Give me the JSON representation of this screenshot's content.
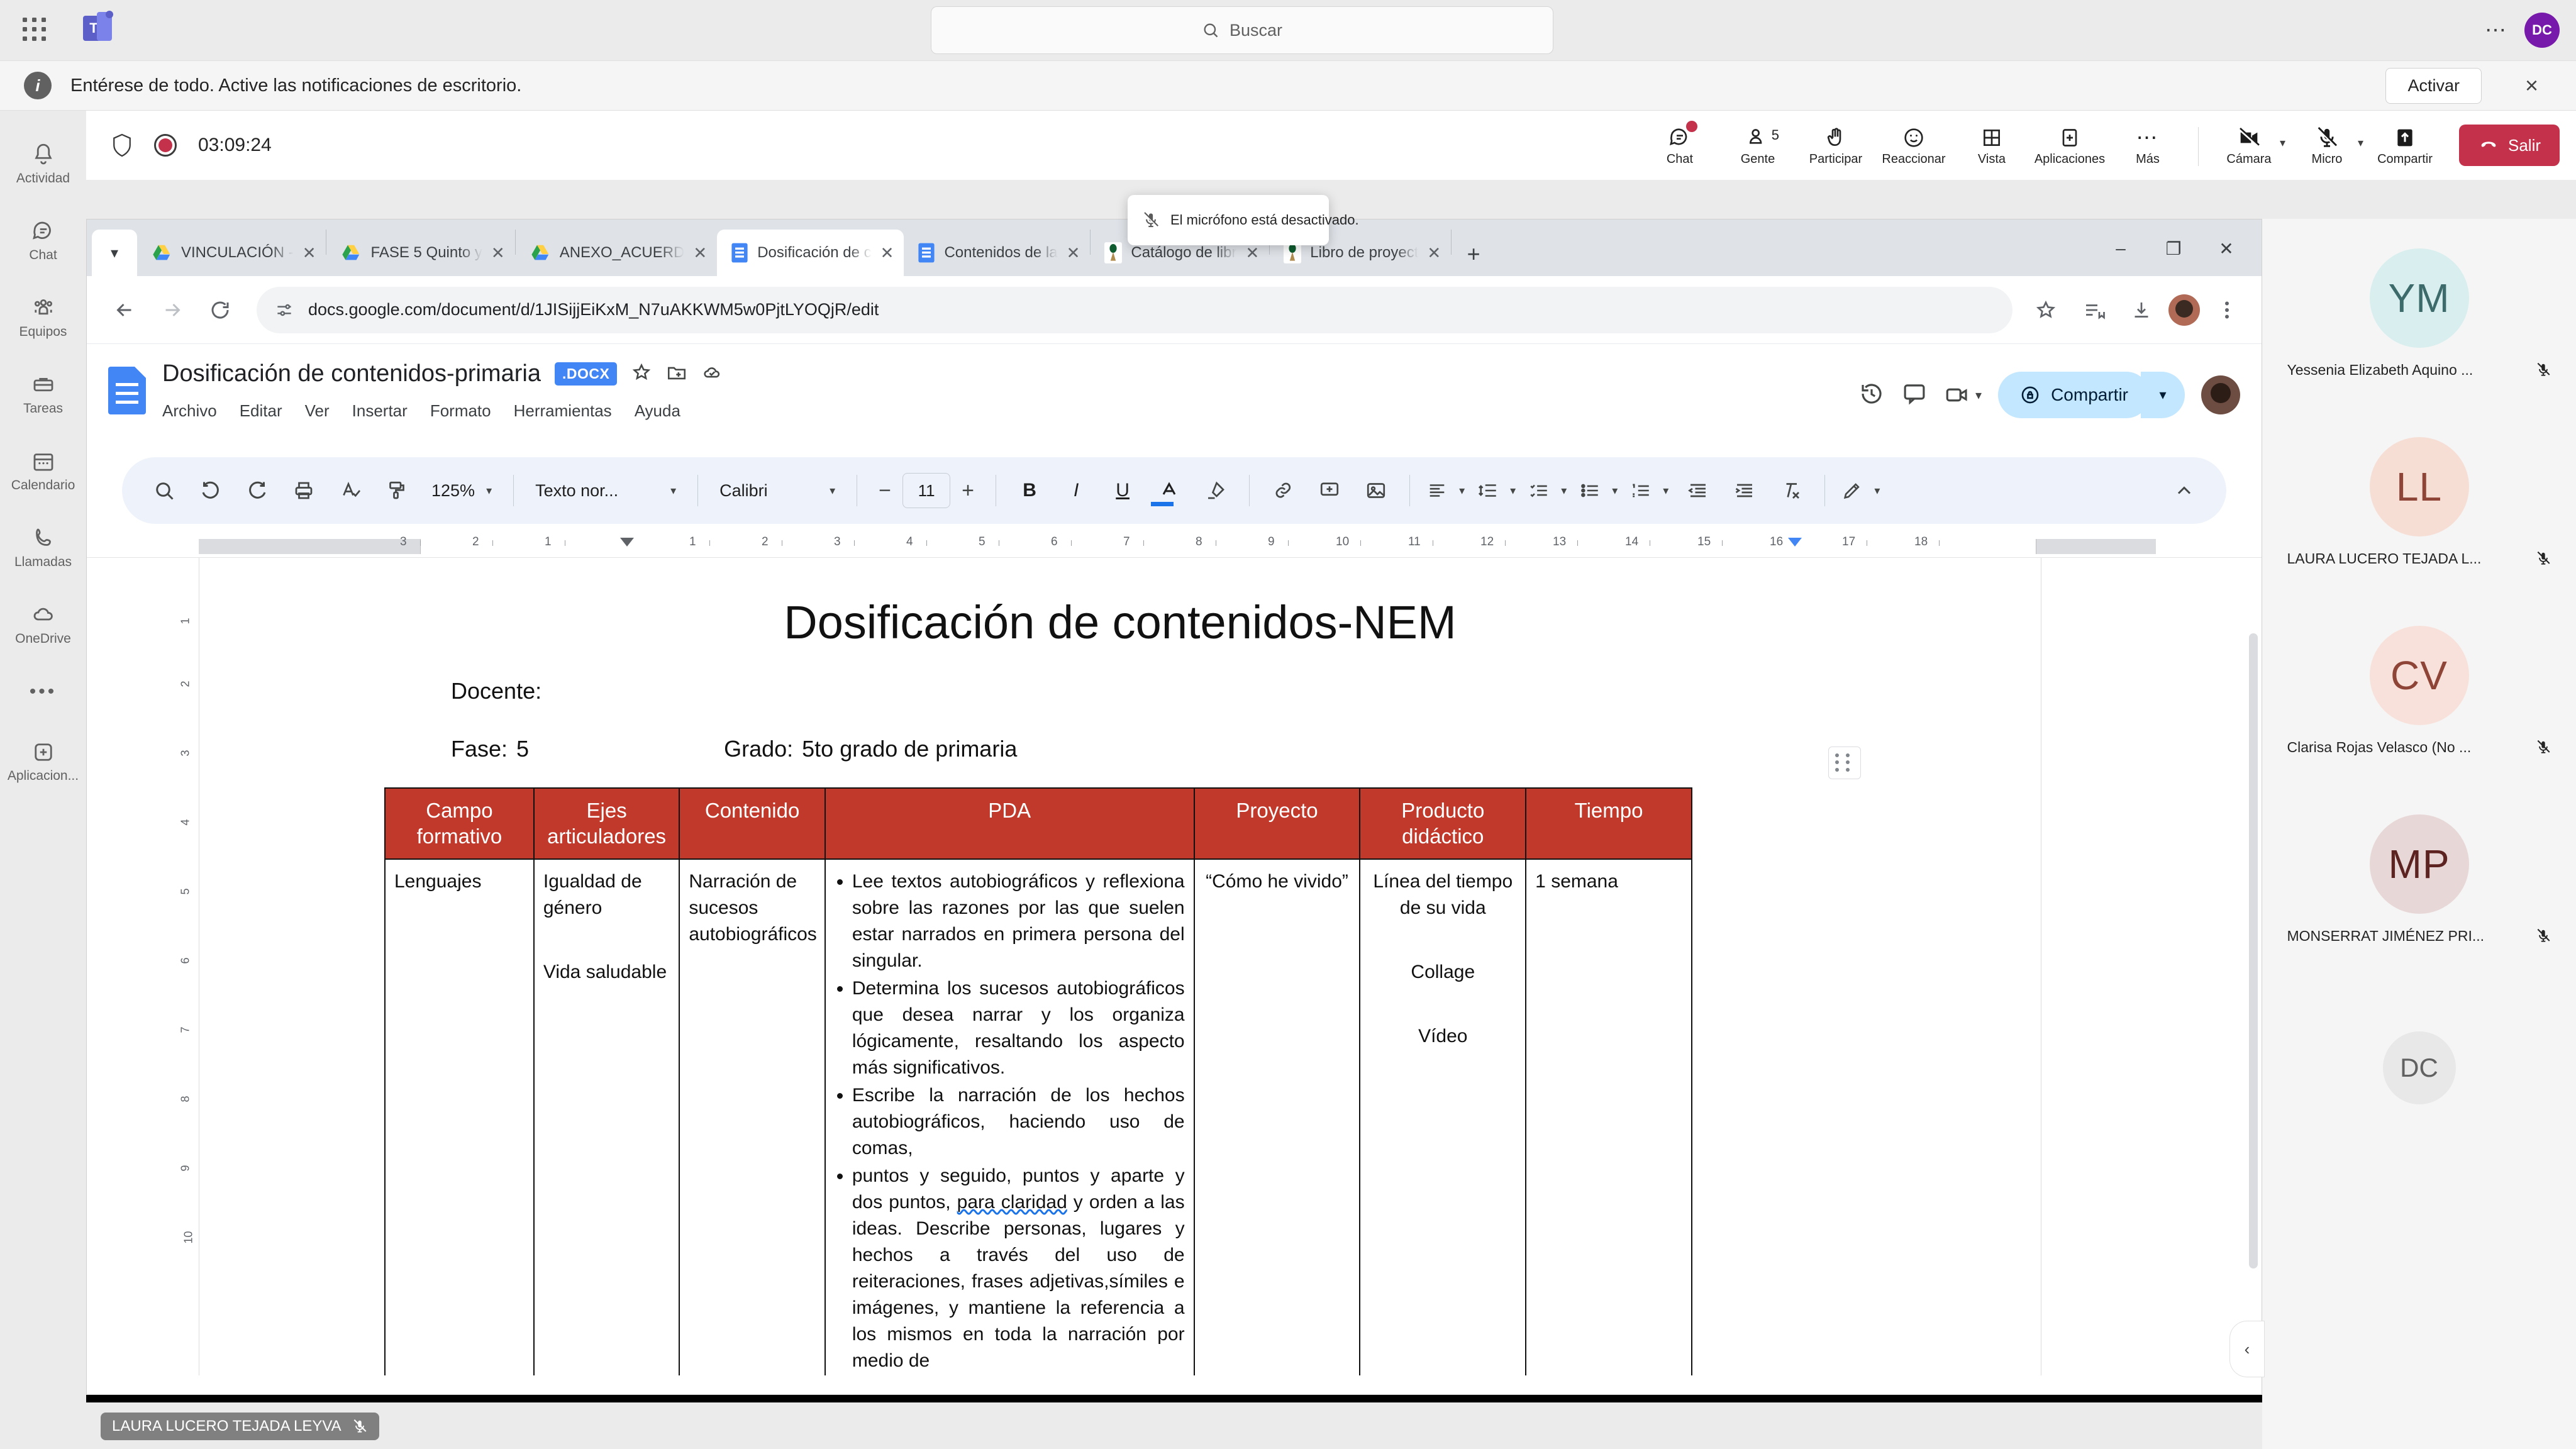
{
  "teams": {
    "search_placeholder": "Buscar",
    "user_initials": "DC",
    "more_icon": "ellipsis-icon",
    "notification": {
      "text": "Entérese de todo. Active las notificaciones de escritorio.",
      "action_label": "Activar",
      "close_label": "×"
    },
    "rail": [
      {
        "label": "Actividad",
        "icon": "bell-icon"
      },
      {
        "label": "Chat",
        "icon": "chat-bubble-icon"
      },
      {
        "label": "Equipos",
        "icon": "people-icon"
      },
      {
        "label": "Tareas",
        "icon": "tasks-icon"
      },
      {
        "label": "Calendario",
        "icon": "calendar-icon"
      },
      {
        "label": "Llamadas",
        "icon": "phone-icon"
      },
      {
        "label": "OneDrive",
        "icon": "cloud-icon"
      },
      {
        "label": "Aplicacion...",
        "icon": "plus-box-icon"
      }
    ],
    "rail_more": "•••"
  },
  "meeting": {
    "timer": "03:09:24",
    "shield_icon": "shield-icon",
    "record_icon": "record-dot-icon",
    "actions": [
      {
        "label": "Chat",
        "icon": "chat-icon",
        "badge": true
      },
      {
        "label": "Gente",
        "icon": "person-icon",
        "count": "5"
      },
      {
        "label": "Participar",
        "icon": "raise-hand-icon"
      },
      {
        "label": "Reaccionar",
        "icon": "emoji-icon"
      },
      {
        "label": "Vista",
        "icon": "grid-view-icon"
      },
      {
        "label": "Aplicaciones",
        "icon": "apps-plus-icon"
      },
      {
        "label": "Más",
        "icon": "ellipsis-icon"
      }
    ],
    "devices": [
      {
        "label": "Cámara",
        "icon": "camera-off-icon",
        "has_chevron": true
      },
      {
        "label": "Micro",
        "icon": "mic-off-icon",
        "has_chevron": true
      },
      {
        "label": "Compartir",
        "icon": "share-screen-icon",
        "has_chevron": false
      }
    ],
    "leave_label": "Salir",
    "leave_color": "#c4314b",
    "toast": {
      "text": "El micrófono está desactivado.",
      "icon": "mic-off-icon"
    },
    "self_name_pill": {
      "name": "LAURA LUCERO TEJADA LEYVA",
      "icon": "mic-off-icon"
    }
  },
  "participants": [
    {
      "initials": "YM",
      "name": "Yessenia Elizabeth Aquino ...",
      "bg": "#d9eeee",
      "fg": "#3d6b6b",
      "muted": true
    },
    {
      "initials": "LL",
      "name": "LAURA LUCERO TEJADA L...",
      "bg": "#f6ded5",
      "fg": "#8e4436",
      "muted": true
    },
    {
      "initials": "CV",
      "name": "Clarisa Rojas Velasco (No ...",
      "bg": "#f8e1da",
      "fg": "#8e4436",
      "muted": true
    },
    {
      "initials": "MP",
      "name": "MONSERRAT JIMÉNEZ PRI...",
      "bg": "#e8d7d7",
      "fg": "#5c2320",
      "muted": true
    },
    {
      "initials": "DC",
      "name": "",
      "bg": "#e8e8e8",
      "fg": "#616161",
      "muted": false,
      "self": true
    }
  ],
  "browser": {
    "tabs": [
      {
        "title": "VINCULACIÓN -",
        "icon": "google-drive-icon",
        "active": false
      },
      {
        "title": "FASE 5 Quinto y",
        "icon": "google-drive-icon",
        "active": false
      },
      {
        "title": "ANEXO_ACUERD",
        "icon": "google-drive-icon",
        "active": false
      },
      {
        "title": "Dosificación de c",
        "icon": "google-docs-icon",
        "active": true
      },
      {
        "title": "Contenidos de la",
        "icon": "google-docs-icon",
        "active": false
      },
      {
        "title": "Catálogo de libr",
        "icon": "gov-seal-icon",
        "active": false
      },
      {
        "title": "Libro de proyect",
        "icon": "gov-seal-icon",
        "active": false
      }
    ],
    "new_tab_label": "+",
    "window_controls": [
      "–",
      "❐",
      "✕"
    ],
    "url": "docs.google.com/document/d/1JISijjEiKxM_N7uAKKWM5w0PjtLYOQjR/edit",
    "site_icon": "tune-icon",
    "bookmark_icon": "star-icon",
    "reading_list_icon": "reading-list-icon",
    "download_icon": "download-icon",
    "profile_icon": "profile-avatar-icon",
    "menu_icon": "kebab-menu-icon"
  },
  "gdocs": {
    "title": "Dosificación de contenidos-primaria",
    "format_badge": ".DOCX",
    "star_icon": "star-icon",
    "move_icon": "move-folder-icon",
    "cloud_icon": "cloud-saved-icon",
    "menu": [
      "Archivo",
      "Editar",
      "Ver",
      "Insertar",
      "Formato",
      "Herramientas",
      "Ayuda"
    ],
    "history_icon": "history-icon",
    "comment_icon": "comment-icon",
    "meet_icon": "video-camera-icon",
    "share_label": "Compartir",
    "share_icon": "lock-share-icon",
    "share_chevron": "▾",
    "toolbar": {
      "search_icon": "search-icon",
      "undo_icon": "undo-icon",
      "redo_icon": "redo-icon",
      "print_icon": "print-icon",
      "spell_icon": "spellcheck-icon",
      "paint_icon": "paint-format-icon",
      "zoom": "125%",
      "style": "Texto nor...",
      "font": "Calibri",
      "font_size": "11",
      "decrease": "−",
      "increase": "+",
      "bold": "B",
      "italic": "I",
      "underline": "U",
      "text_color_icon": "text-color-icon",
      "highlight_icon": "highlight-icon",
      "link_icon": "link-icon",
      "comment_add_icon": "add-comment-icon",
      "image_icon": "insert-image-icon",
      "align_icon": "align-icon",
      "line_spacing_icon": "line-spacing-icon",
      "checklist_icon": "checklist-icon",
      "bullet_list_icon": "bulleted-list-icon",
      "numbered_list_icon": "numbered-list-icon",
      "indent_less_icon": "indent-decrease-icon",
      "indent_more_icon": "indent-increase-icon",
      "clear_format_icon": "clear-formatting-icon",
      "edit_mode_icon": "pencil-mode-icon",
      "collapse_icon": "chevron-up-icon"
    },
    "ruler_numbers": [
      "3",
      "2",
      "1",
      "1",
      "2",
      "3",
      "4",
      "5",
      "6",
      "7",
      "8",
      "9",
      "10",
      "11",
      "12",
      "13",
      "14",
      "15",
      "16",
      "17",
      "18"
    ],
    "outline_icon": "document-outline-icon"
  },
  "document": {
    "title": "Dosificación de contenidos-NEM",
    "docente_label": "Docente:",
    "fase_label": "Fase:",
    "fase_value": "5",
    "grado_label": "Grado:",
    "grado_value": "5to grado de primaria",
    "table": {
      "header_bg": "#c0392b",
      "headers": [
        "Campo formativo",
        "Ejes articuladores",
        "Contenido",
        "PDA",
        "Proyecto",
        "Producto didáctico",
        "Tiempo"
      ],
      "rows": [
        {
          "campo": "Lenguajes",
          "ejes": [
            "Igualdad de género",
            "Vida saludable"
          ],
          "contenido": "Narración de sucesos autobiográficos",
          "pda": [
            "Lee textos autobiográficos y reflexiona sobre las razones por las que suelen estar narrados en primera persona del singular.",
            "Determina los sucesos autobiográficos que desea narrar y los organiza lógicamente, resaltando los aspecto más significativos.",
            "Escribe la narración de los hechos autobiográficos, haciendo uso de comas,",
            "puntos y seguido, puntos y aparte y dos puntos, para claridad y orden a las ideas. Describe personas, lugares y hechos a través del uso de reiteraciones, frases adjetivas,símiles e imágenes, y mantiene la referencia a los mismos en toda la narración por medio de"
          ],
          "pda_spell_phrase": "para claridad",
          "proyecto": "“Cómo he vivido”",
          "productos": [
            "Línea del tiempo de su vida",
            "Collage",
            "Vídeo"
          ],
          "tiempo": "1 semana"
        }
      ]
    }
  }
}
